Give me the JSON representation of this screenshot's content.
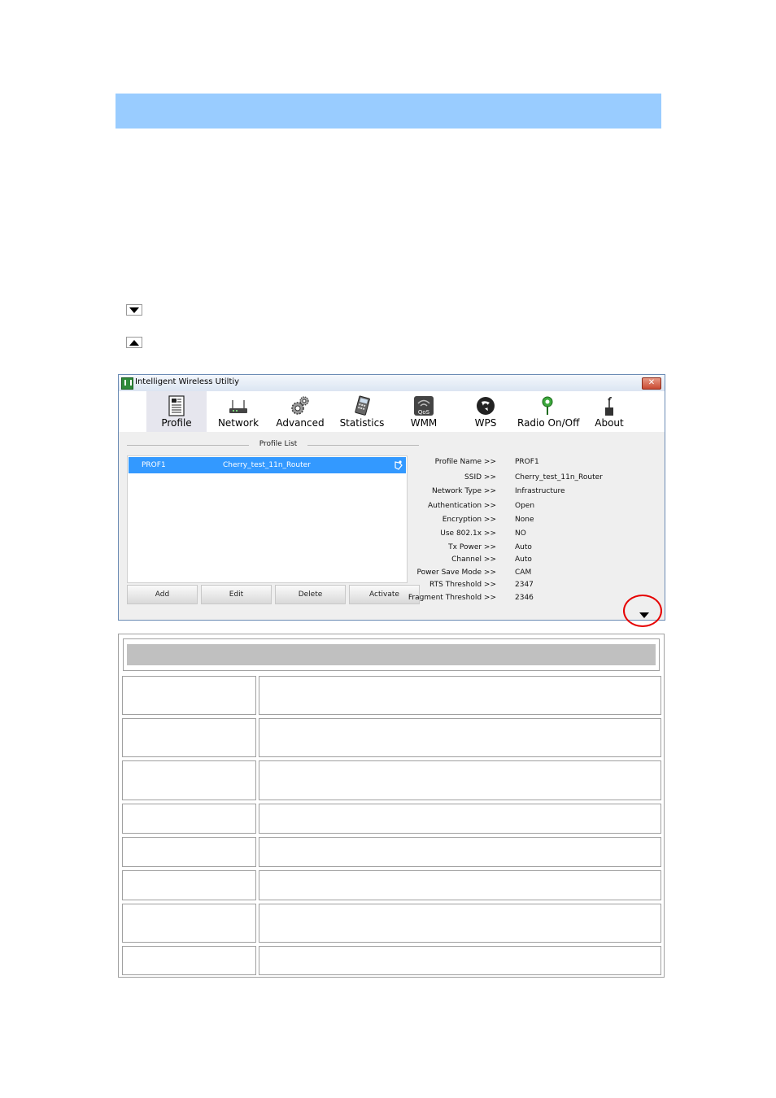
{
  "page": {
    "toggle_down_icon": "triangle-down-icon",
    "toggle_up_icon": "triangle-up-icon"
  },
  "window": {
    "title": "Intelligent Wireless Utiltiy",
    "close_label": "✕",
    "toolbar": [
      {
        "label": "Profile",
        "icon": "profile-icon",
        "active": true
      },
      {
        "label": "Network",
        "icon": "network-icon",
        "active": false
      },
      {
        "label": "Advanced",
        "icon": "advanced-icon",
        "active": false
      },
      {
        "label": "Statistics",
        "icon": "statistics-icon",
        "active": false
      },
      {
        "label": "WMM",
        "icon": "wmm-icon",
        "active": false
      },
      {
        "label": "WPS",
        "icon": "wps-icon",
        "active": false
      },
      {
        "label": "Radio On/Off",
        "icon": "radio-icon",
        "active": false
      },
      {
        "label": "About",
        "icon": "about-icon",
        "active": false
      }
    ],
    "profile_list": {
      "title": "Profile List",
      "rows": [
        {
          "name": "PROF1",
          "ssid": "Cherry_test_11n_Router"
        }
      ]
    },
    "buttons": {
      "add": "Add",
      "edit": "Edit",
      "delete": "Delete",
      "activate": "Activate"
    },
    "details": [
      {
        "key": "Profile Name >>",
        "value": "PROF1"
      },
      {
        "key": "SSID >>",
        "value": "Cherry_test_11n_Router"
      },
      {
        "key": "Network Type >>",
        "value": "Infrastructure"
      },
      {
        "key": "Authentication >>",
        "value": "Open"
      },
      {
        "key": "Encryption >>",
        "value": "None"
      },
      {
        "key": "Use 802.1x >>",
        "value": "NO"
      },
      {
        "key": "Tx Power >>",
        "value": "Auto"
      },
      {
        "key": "Channel >>",
        "value": "Auto"
      },
      {
        "key": "Power Save Mode >>",
        "value": "CAM"
      },
      {
        "key": "RTS Threshold >>",
        "value": "2347"
      },
      {
        "key": "Fragment Threshold >>",
        "value": "2346"
      }
    ]
  },
  "colors": {
    "header_band": "#99ccff",
    "selection": "#3399ff",
    "highlight_circle": "#e60000"
  }
}
